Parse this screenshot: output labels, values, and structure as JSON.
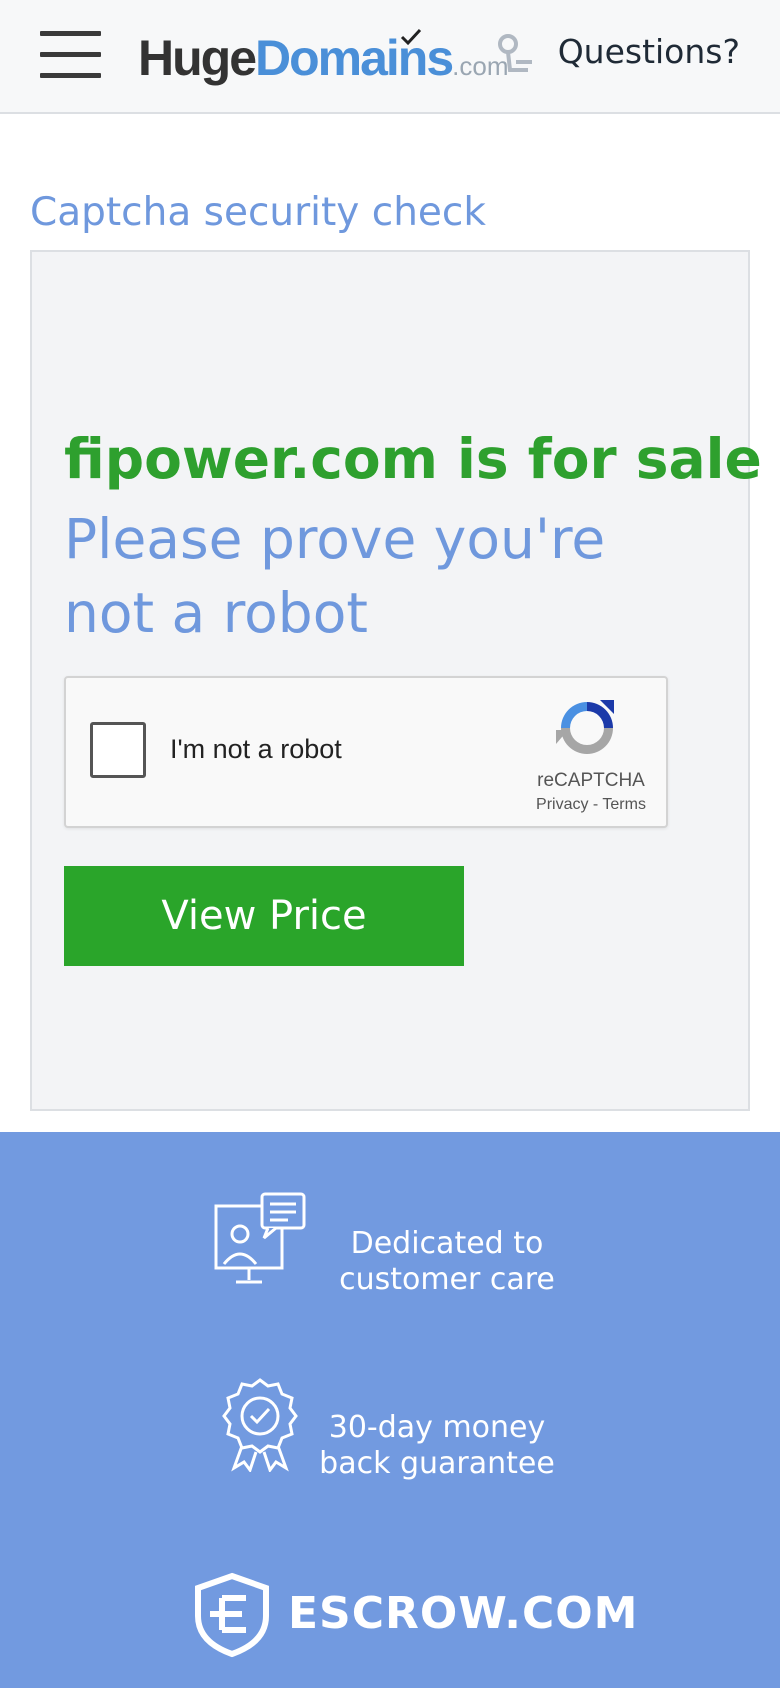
{
  "header": {
    "logo": {
      "part1": "Huge",
      "part2": "Domains",
      "part3": ".com"
    },
    "questions_label": "Questions?"
  },
  "page_title": "Captcha security check",
  "panel": {
    "sale_text": "fipower.com is for sale",
    "prove_text": "Please prove you're not a robot",
    "recaptcha": {
      "label": "I'm not a robot",
      "brand": "reCAPTCHA",
      "privacy": "Privacy",
      "separator": " - ",
      "terms": "Terms",
      "checked": false
    },
    "view_price_label": "View Price"
  },
  "footer": {
    "feature_1": {
      "line1": "Dedicated to",
      "line2": "customer care",
      "icon": "customer-care-icon"
    },
    "feature_2": {
      "line1": "30-day money",
      "line2": "back guarantee",
      "icon": "guarantee-badge-icon"
    },
    "escrow_label": "ESCROW.COM"
  },
  "colors": {
    "brand_blue": "#4a8fd8",
    "title_blue": "#6f98dd",
    "sale_green": "#2ea02e",
    "button_green": "#2aa52a",
    "footer_blue": "#729ae0"
  }
}
